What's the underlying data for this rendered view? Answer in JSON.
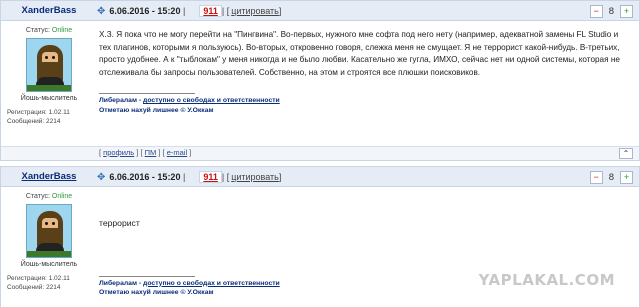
{
  "posts": [
    {
      "author": "XanderBass",
      "status_label": "Статус:",
      "status_value": "Online",
      "rank": "Йошь-мыслитель",
      "registration": "Регистрация: 1.02.11",
      "messages": "Сообщений: 2214",
      "date": "6.06.2016 - 15:20",
      "post_number": "911",
      "cite_label": "цитировать",
      "rating": "8",
      "text": "Х.З. Я пока что не могу перейти на \"Пингвина\". Во-первых, нужного мне софта под него нету (например, адекватной замены FL Studio и тех плагинов, которыми я пользуюсь). Во-вторых, откровенно говоря, слежка меня не смущает. Я не террорист какой-нибудь. В-третьих, просто удобнее. А к \"тыблокам\" у меня никогда и не было любви. Касательно же гугла, ИМХО, сейчас нет ни одной системы, которая не отслеживала бы запросы пользователей. Собственно, на этом и строятся все плюшки поисковиков.",
      "signature_line1_prefix": "Либералам - ",
      "signature_line1_link": "доступно о свободах и ответственности",
      "signature_line2": "Отметаю нахуй лишнее © У.Оккам",
      "footer_profile": "профиль",
      "footer_pm": "ПМ",
      "footer_email": "e-mail"
    },
    {
      "author": "XanderBass",
      "status_label": "Статус:",
      "status_value": "Online",
      "rank": "Йошь-мыслитель",
      "registration": "Регистрация: 1.02.11",
      "messages": "Сообщений: 2214",
      "date": "6.06.2016 - 15:20",
      "post_number": "911",
      "cite_label": "цитировать",
      "rating": "8",
      "text": "террорист",
      "signature_line1_prefix": "Либералам - ",
      "signature_line1_link": "доступно о свободах и ответственности",
      "signature_line2": "Отметаю нахуй лишнее © У.Оккам"
    }
  ],
  "icons": {
    "pin": "pin-icon",
    "minus": "vote-down-icon",
    "plus": "vote-up-icon",
    "up": "scroll-up-icon"
  },
  "watermark": "YAPLAKAL.COM",
  "colors": {
    "header_bg": "#e6ecf6",
    "author": "#0a2d7a",
    "online": "#2b9a3a",
    "post_number": "#c81313"
  }
}
